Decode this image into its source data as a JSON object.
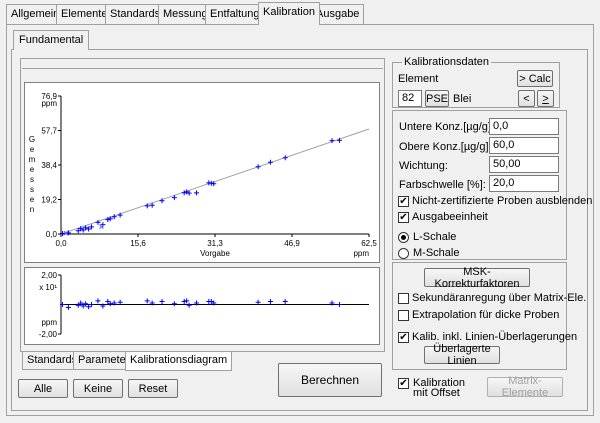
{
  "tabs": [
    "Allgemein",
    "Elemente",
    "Standards",
    "Messung",
    "Entfaltung",
    "Kalibration",
    "Ausgabe"
  ],
  "active_tab": "Kalibration",
  "subtab": "Fundamental",
  "calib": {
    "group_title": "Kalibrationsdaten",
    "element_label": "Element",
    "calc_button": "> Calc",
    "element_number": "82",
    "pse_button": "PSE",
    "element_name": "Blei",
    "prev_button": "<",
    "next_button": ">"
  },
  "fields": {
    "lower_label": "Untere Konz.[µg/g]:",
    "lower_value": "0,0",
    "upper_label": "Obere Konz.[µg/g]:",
    "upper_value": "60,0",
    "weight_label": "Wichtung:",
    "weight_value": "50,00",
    "color_label": "Farbschwelle [%]:",
    "color_value": "20,0"
  },
  "options": {
    "hide_noncert": "Nicht-zertifizierte Proben ausblenden",
    "output_unit": "Ausgabeeinheit",
    "l_scale": "L-Schale",
    "m_scale": "M-Schale"
  },
  "correction": {
    "msk_button": "MSK-Korrekturfaktoren",
    "secondary": "Sekundäranregung über Matrix-Ele.",
    "extrapolation": "Extrapolation für dicke Proben",
    "kalib_overlap": "Kalib. inkl. Linien-Überlagerungen",
    "overlap_button": "Überlagerte Linien"
  },
  "bottom": {
    "compute_button": "Berechnen",
    "offset_label_1": "Kalibration",
    "offset_label_2": "mit Offset",
    "matrix_button": "Matrix-Elemente",
    "all_button": "Alle",
    "none_button": "Keine",
    "reset_button": "Reset"
  },
  "plot_tabs": [
    "Standards",
    "Parameter",
    "Kalibrationsdiagram"
  ],
  "active_plot_tab": "Kalibrationsdiagram",
  "chart_data": [
    {
      "type": "scatter",
      "ylabel": "Gemessen",
      "yunit": "ppm",
      "xlabel": "Vorgabe",
      "xunit": "ppm",
      "xlim": [
        0,
        62.5
      ],
      "ylim": [
        0,
        76.9
      ],
      "xticks": [
        "0,0",
        "15,6",
        "31,3",
        "46,9",
        "62,5"
      ],
      "yticks": [
        "0,0",
        "19,2",
        "38,4",
        "57,7",
        "76,9"
      ],
      "fit_line": [
        [
          0,
          0
        ],
        [
          62.5,
          58.5
        ]
      ],
      "points": [
        [
          0.3,
          0.3
        ],
        [
          1.5,
          0.6
        ],
        [
          3.5,
          1.8
        ],
        [
          4.0,
          3.0
        ],
        [
          4.5,
          2.2
        ],
        [
          5.0,
          3.5
        ],
        [
          5.6,
          2.8
        ],
        [
          6.2,
          4.0
        ],
        [
          7.5,
          6.5
        ],
        [
          8.5,
          5.2
        ],
        [
          9.5,
          8.0
        ],
        [
          10.0,
          8.5
        ],
        [
          10.8,
          9.6
        ],
        [
          12.0,
          10.5
        ],
        [
          17.5,
          15.7
        ],
        [
          18.5,
          16.0
        ],
        [
          20.5,
          18.5
        ],
        [
          23.0,
          20.3
        ],
        [
          25.0,
          23.0
        ],
        [
          25.5,
          23.5
        ],
        [
          26.0,
          22.8
        ],
        [
          27.5,
          22.9
        ],
        [
          30.0,
          28.5
        ],
        [
          30.5,
          28.3
        ],
        [
          31.0,
          28.0
        ],
        [
          40.0,
          37.5
        ],
        [
          42.5,
          40.0
        ],
        [
          45.5,
          42.5
        ],
        [
          55.0,
          52.0
        ],
        [
          56.5,
          52.2
        ]
      ],
      "cross_points": [
        [
          1.0,
          0.5
        ],
        [
          8.2,
          4.0
        ]
      ]
    },
    {
      "type": "scatter",
      "yscale_label": "x 10¹",
      "yunit": "ppm",
      "ylim": [
        -2.0,
        2.0
      ],
      "yticks": [
        "2,00",
        "-2,00"
      ],
      "residuals": [
        [
          0.3,
          0.0
        ],
        [
          1.5,
          -0.2
        ],
        [
          3.5,
          -0.05
        ],
        [
          4.0,
          0.1
        ],
        [
          4.5,
          -0.1
        ],
        [
          5.0,
          0.05
        ],
        [
          5.6,
          -0.15
        ],
        [
          6.2,
          0.0
        ],
        [
          7.5,
          0.25
        ],
        [
          8.5,
          -0.1
        ],
        [
          9.5,
          0.2
        ],
        [
          10.0,
          0.05
        ],
        [
          10.8,
          0.1
        ],
        [
          12.0,
          0.15
        ],
        [
          17.5,
          0.25
        ],
        [
          18.5,
          0.1
        ],
        [
          20.5,
          0.2
        ],
        [
          23.0,
          0.05
        ],
        [
          25.0,
          0.2
        ],
        [
          25.5,
          0.25
        ],
        [
          26.0,
          -0.05
        ],
        [
          27.5,
          0.1
        ],
        [
          30.0,
          0.2
        ],
        [
          30.5,
          0.2
        ],
        [
          31.0,
          0.1
        ],
        [
          40.0,
          0.15
        ],
        [
          42.5,
          0.2
        ],
        [
          45.5,
          0.2
        ],
        [
          55.0,
          0.1
        ],
        [
          56.5,
          0.0
        ]
      ]
    }
  ]
}
